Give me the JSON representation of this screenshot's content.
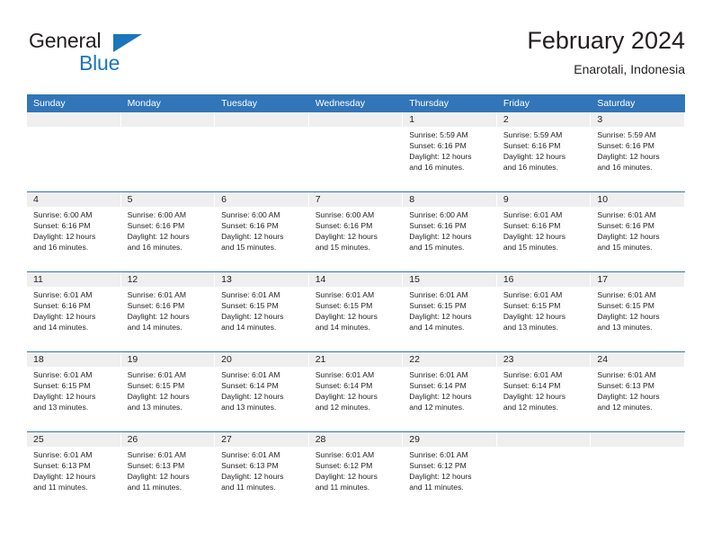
{
  "brand": {
    "name_top": "General",
    "name_bottom": "Blue",
    "triangle_color": "#1b75bb"
  },
  "header": {
    "title": "February 2024",
    "location": "Enarotali, Indonesia"
  },
  "theme": {
    "header_blue": "#3275b9",
    "row_band": "#efefef",
    "text": "#231f20"
  },
  "weekdays": [
    "Sunday",
    "Monday",
    "Tuesday",
    "Wednesday",
    "Thursday",
    "Friday",
    "Saturday"
  ],
  "weeks": [
    [
      {
        "day": "",
        "sunrise": "",
        "sunset": "",
        "daylight1": "",
        "daylight2": ""
      },
      {
        "day": "",
        "sunrise": "",
        "sunset": "",
        "daylight1": "",
        "daylight2": ""
      },
      {
        "day": "",
        "sunrise": "",
        "sunset": "",
        "daylight1": "",
        "daylight2": ""
      },
      {
        "day": "",
        "sunrise": "",
        "sunset": "",
        "daylight1": "",
        "daylight2": ""
      },
      {
        "day": "1",
        "sunrise": "Sunrise: 5:59 AM",
        "sunset": "Sunset: 6:16 PM",
        "daylight1": "Daylight: 12 hours",
        "daylight2": "and 16 minutes."
      },
      {
        "day": "2",
        "sunrise": "Sunrise: 5:59 AM",
        "sunset": "Sunset: 6:16 PM",
        "daylight1": "Daylight: 12 hours",
        "daylight2": "and 16 minutes."
      },
      {
        "day": "3",
        "sunrise": "Sunrise: 5:59 AM",
        "sunset": "Sunset: 6:16 PM",
        "daylight1": "Daylight: 12 hours",
        "daylight2": "and 16 minutes."
      }
    ],
    [
      {
        "day": "4",
        "sunrise": "Sunrise: 6:00 AM",
        "sunset": "Sunset: 6:16 PM",
        "daylight1": "Daylight: 12 hours",
        "daylight2": "and 16 minutes."
      },
      {
        "day": "5",
        "sunrise": "Sunrise: 6:00 AM",
        "sunset": "Sunset: 6:16 PM",
        "daylight1": "Daylight: 12 hours",
        "daylight2": "and 16 minutes."
      },
      {
        "day": "6",
        "sunrise": "Sunrise: 6:00 AM",
        "sunset": "Sunset: 6:16 PM",
        "daylight1": "Daylight: 12 hours",
        "daylight2": "and 15 minutes."
      },
      {
        "day": "7",
        "sunrise": "Sunrise: 6:00 AM",
        "sunset": "Sunset: 6:16 PM",
        "daylight1": "Daylight: 12 hours",
        "daylight2": "and 15 minutes."
      },
      {
        "day": "8",
        "sunrise": "Sunrise: 6:00 AM",
        "sunset": "Sunset: 6:16 PM",
        "daylight1": "Daylight: 12 hours",
        "daylight2": "and 15 minutes."
      },
      {
        "day": "9",
        "sunrise": "Sunrise: 6:01 AM",
        "sunset": "Sunset: 6:16 PM",
        "daylight1": "Daylight: 12 hours",
        "daylight2": "and 15 minutes."
      },
      {
        "day": "10",
        "sunrise": "Sunrise: 6:01 AM",
        "sunset": "Sunset: 6:16 PM",
        "daylight1": "Daylight: 12 hours",
        "daylight2": "and 15 minutes."
      }
    ],
    [
      {
        "day": "11",
        "sunrise": "Sunrise: 6:01 AM",
        "sunset": "Sunset: 6:16 PM",
        "daylight1": "Daylight: 12 hours",
        "daylight2": "and 14 minutes."
      },
      {
        "day": "12",
        "sunrise": "Sunrise: 6:01 AM",
        "sunset": "Sunset: 6:16 PM",
        "daylight1": "Daylight: 12 hours",
        "daylight2": "and 14 minutes."
      },
      {
        "day": "13",
        "sunrise": "Sunrise: 6:01 AM",
        "sunset": "Sunset: 6:15 PM",
        "daylight1": "Daylight: 12 hours",
        "daylight2": "and 14 minutes."
      },
      {
        "day": "14",
        "sunrise": "Sunrise: 6:01 AM",
        "sunset": "Sunset: 6:15 PM",
        "daylight1": "Daylight: 12 hours",
        "daylight2": "and 14 minutes."
      },
      {
        "day": "15",
        "sunrise": "Sunrise: 6:01 AM",
        "sunset": "Sunset: 6:15 PM",
        "daylight1": "Daylight: 12 hours",
        "daylight2": "and 14 minutes."
      },
      {
        "day": "16",
        "sunrise": "Sunrise: 6:01 AM",
        "sunset": "Sunset: 6:15 PM",
        "daylight1": "Daylight: 12 hours",
        "daylight2": "and 13 minutes."
      },
      {
        "day": "17",
        "sunrise": "Sunrise: 6:01 AM",
        "sunset": "Sunset: 6:15 PM",
        "daylight1": "Daylight: 12 hours",
        "daylight2": "and 13 minutes."
      }
    ],
    [
      {
        "day": "18",
        "sunrise": "Sunrise: 6:01 AM",
        "sunset": "Sunset: 6:15 PM",
        "daylight1": "Daylight: 12 hours",
        "daylight2": "and 13 minutes."
      },
      {
        "day": "19",
        "sunrise": "Sunrise: 6:01 AM",
        "sunset": "Sunset: 6:15 PM",
        "daylight1": "Daylight: 12 hours",
        "daylight2": "and 13 minutes."
      },
      {
        "day": "20",
        "sunrise": "Sunrise: 6:01 AM",
        "sunset": "Sunset: 6:14 PM",
        "daylight1": "Daylight: 12 hours",
        "daylight2": "and 13 minutes."
      },
      {
        "day": "21",
        "sunrise": "Sunrise: 6:01 AM",
        "sunset": "Sunset: 6:14 PM",
        "daylight1": "Daylight: 12 hours",
        "daylight2": "and 12 minutes."
      },
      {
        "day": "22",
        "sunrise": "Sunrise: 6:01 AM",
        "sunset": "Sunset: 6:14 PM",
        "daylight1": "Daylight: 12 hours",
        "daylight2": "and 12 minutes."
      },
      {
        "day": "23",
        "sunrise": "Sunrise: 6:01 AM",
        "sunset": "Sunset: 6:14 PM",
        "daylight1": "Daylight: 12 hours",
        "daylight2": "and 12 minutes."
      },
      {
        "day": "24",
        "sunrise": "Sunrise: 6:01 AM",
        "sunset": "Sunset: 6:13 PM",
        "daylight1": "Daylight: 12 hours",
        "daylight2": "and 12 minutes."
      }
    ],
    [
      {
        "day": "25",
        "sunrise": "Sunrise: 6:01 AM",
        "sunset": "Sunset: 6:13 PM",
        "daylight1": "Daylight: 12 hours",
        "daylight2": "and 11 minutes."
      },
      {
        "day": "26",
        "sunrise": "Sunrise: 6:01 AM",
        "sunset": "Sunset: 6:13 PM",
        "daylight1": "Daylight: 12 hours",
        "daylight2": "and 11 minutes."
      },
      {
        "day": "27",
        "sunrise": "Sunrise: 6:01 AM",
        "sunset": "Sunset: 6:13 PM",
        "daylight1": "Daylight: 12 hours",
        "daylight2": "and 11 minutes."
      },
      {
        "day": "28",
        "sunrise": "Sunrise: 6:01 AM",
        "sunset": "Sunset: 6:12 PM",
        "daylight1": "Daylight: 12 hours",
        "daylight2": "and 11 minutes."
      },
      {
        "day": "29",
        "sunrise": "Sunrise: 6:01 AM",
        "sunset": "Sunset: 6:12 PM",
        "daylight1": "Daylight: 12 hours",
        "daylight2": "and 11 minutes."
      },
      {
        "day": "",
        "sunrise": "",
        "sunset": "",
        "daylight1": "",
        "daylight2": ""
      },
      {
        "day": "",
        "sunrise": "",
        "sunset": "",
        "daylight1": "",
        "daylight2": ""
      }
    ]
  ]
}
